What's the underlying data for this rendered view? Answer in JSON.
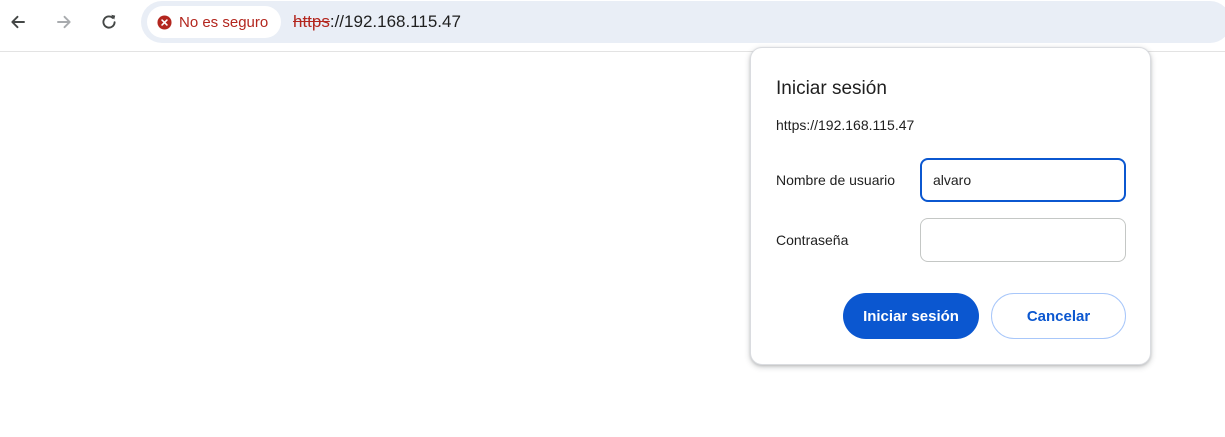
{
  "toolbar": {
    "back_icon": "arrow-left-icon",
    "forward_icon": "arrow-right-icon",
    "reload_icon": "reload-icon"
  },
  "omnibox": {
    "security_label": "No es seguro",
    "security_icon": "error-circle-x-icon",
    "security_color": "#b3261e",
    "url_scheme": "https",
    "url_rest": "://192.168.115.47",
    "background": "#e9eef6"
  },
  "dialog": {
    "title": "Iniciar sesión",
    "origin": "https://192.168.115.47",
    "username_label": "Nombre de usuario",
    "username_value": "alvaro",
    "password_label": "Contraseña",
    "password_value": "",
    "signin_label": "Iniciar sesión",
    "cancel_label": "Cancelar",
    "accent": "#0b57d0"
  }
}
